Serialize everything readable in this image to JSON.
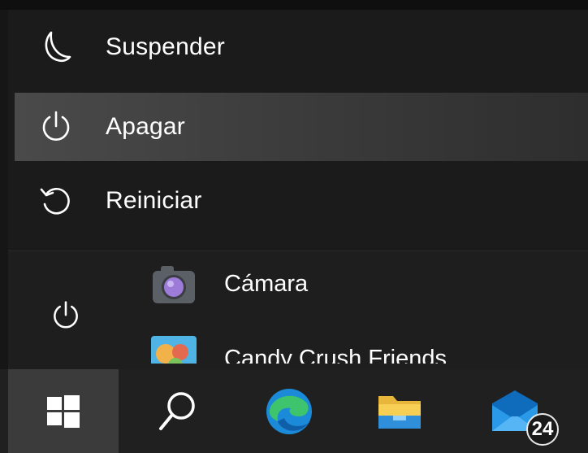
{
  "power_menu": {
    "items": [
      {
        "label": "Suspender",
        "icon": "moon-icon"
      },
      {
        "label": "Apagar",
        "icon": "power-icon",
        "highlighted": true
      },
      {
        "label": "Reiniciar",
        "icon": "restart-icon"
      }
    ]
  },
  "start_menu": {
    "apps": [
      {
        "label": "Cámara",
        "icon": "camera-icon"
      },
      {
        "label": "Candy Crush Friends",
        "icon": "candy-crush-icon"
      }
    ],
    "power_button_icon": "power-icon"
  },
  "taskbar": {
    "buttons": [
      {
        "name": "start",
        "icon": "windows-logo-icon"
      },
      {
        "name": "search",
        "icon": "search-icon"
      },
      {
        "name": "edge",
        "icon": "edge-browser-icon"
      },
      {
        "name": "file-explorer",
        "icon": "folder-icon"
      },
      {
        "name": "mail",
        "icon": "mail-icon"
      }
    ],
    "mail_badge": "24"
  },
  "colors": {
    "menu_background": "#1b1b1b",
    "highlight": "#4a4a4a",
    "taskbar": "#202020",
    "start_button_active": "#3b3b3b",
    "text": "#ffffff"
  }
}
